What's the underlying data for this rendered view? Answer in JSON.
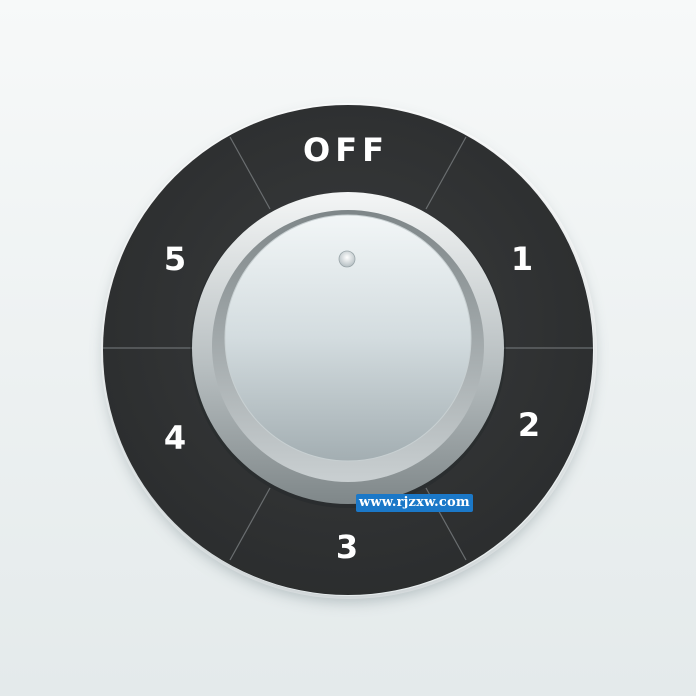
{
  "dial": {
    "labels": {
      "off": "OFF",
      "one": "1",
      "two": "2",
      "three": "3",
      "four": "4",
      "five": "5"
    },
    "selected": "OFF",
    "colors": {
      "ring": "#2e3031",
      "divider": "#6a6e70",
      "knob_light": "#eef3f4",
      "knob_dark": "#aab4b8",
      "label": "#ffffff"
    }
  },
  "watermark": {
    "text": "www.rjzxw.com",
    "color": "#1b78c8"
  }
}
